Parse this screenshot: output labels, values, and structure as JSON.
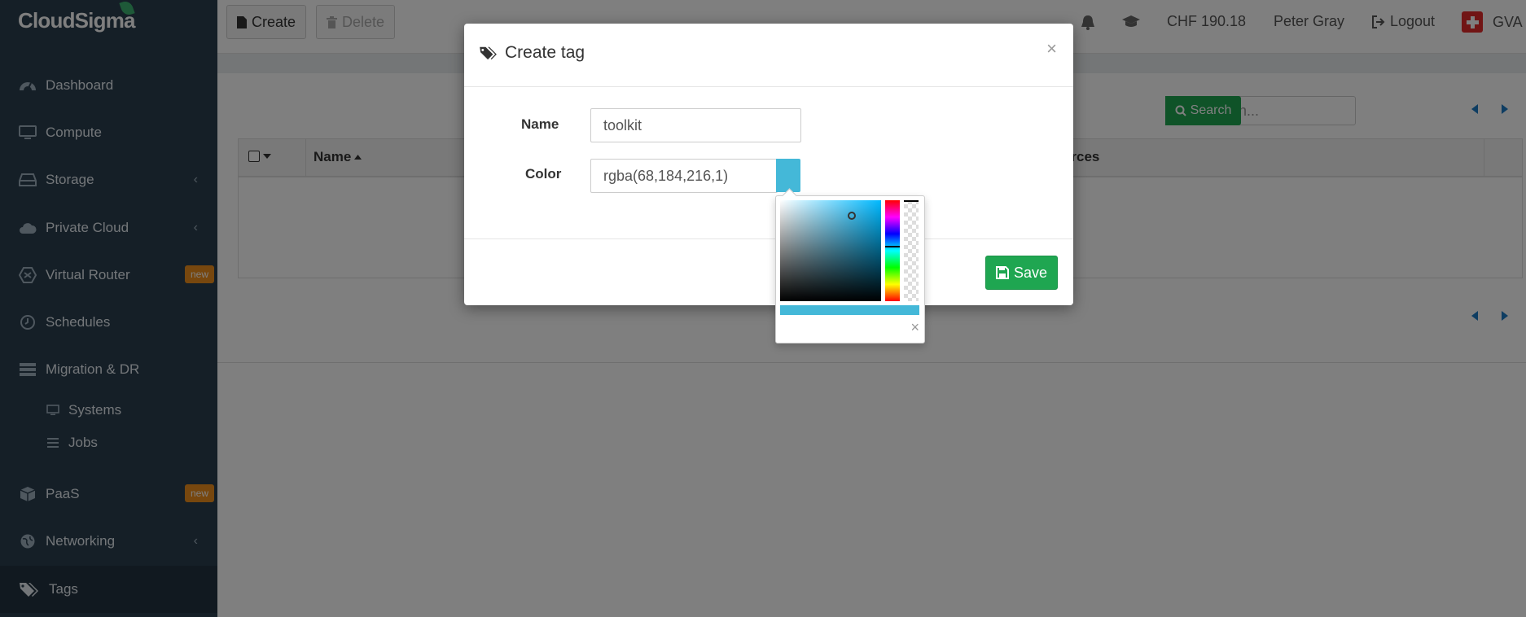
{
  "app": {
    "logo_text": "CloudSigma"
  },
  "sidebar": {
    "items": [
      {
        "label": "Dashboard",
        "icon": "dashboard-icon"
      },
      {
        "label": "Compute",
        "icon": "monitor-icon"
      },
      {
        "label": "Storage",
        "icon": "hdd-icon",
        "chevron": "‹"
      },
      {
        "label": "Private Cloud",
        "icon": "cloud-icon",
        "chevron": "‹"
      },
      {
        "label": "Virtual Router",
        "icon": "router-icon",
        "badge": "new"
      },
      {
        "label": "Schedules",
        "icon": "clock-icon"
      },
      {
        "label": "Migration & DR",
        "icon": "server-icon"
      },
      {
        "label": "Systems",
        "icon": "desktop-icon"
      },
      {
        "label": "Jobs",
        "icon": "list-icon"
      },
      {
        "label": "PaaS",
        "icon": "cube-icon",
        "badge": "new"
      },
      {
        "label": "Networking",
        "icon": "globe-icon",
        "chevron": "‹"
      },
      {
        "label": "Tags",
        "icon": "tags-icon"
      }
    ]
  },
  "toolbar": {
    "create_label": "Create",
    "delete_label": "Delete"
  },
  "topbar": {
    "balance": "CHF 190.18",
    "user": "Peter Gray",
    "logout": "Logout",
    "region": "GVA"
  },
  "list": {
    "search_placeholder": "Search...",
    "search_button": "Search",
    "columns": [
      "Name",
      "urces"
    ]
  },
  "modal": {
    "title": "Create tag",
    "close": "×",
    "name_label": "Name",
    "name_value": "toolkit",
    "color_label": "Color",
    "color_value": "rgba(68,184,216,1)",
    "save_label": "Save"
  },
  "picker": {
    "close": "×"
  },
  "colors": {
    "sidebar": "#2a3e4f",
    "accent_green": "#1fa651",
    "badge_orange": "#ef8f1c",
    "selected_color": "#44b8d8"
  }
}
